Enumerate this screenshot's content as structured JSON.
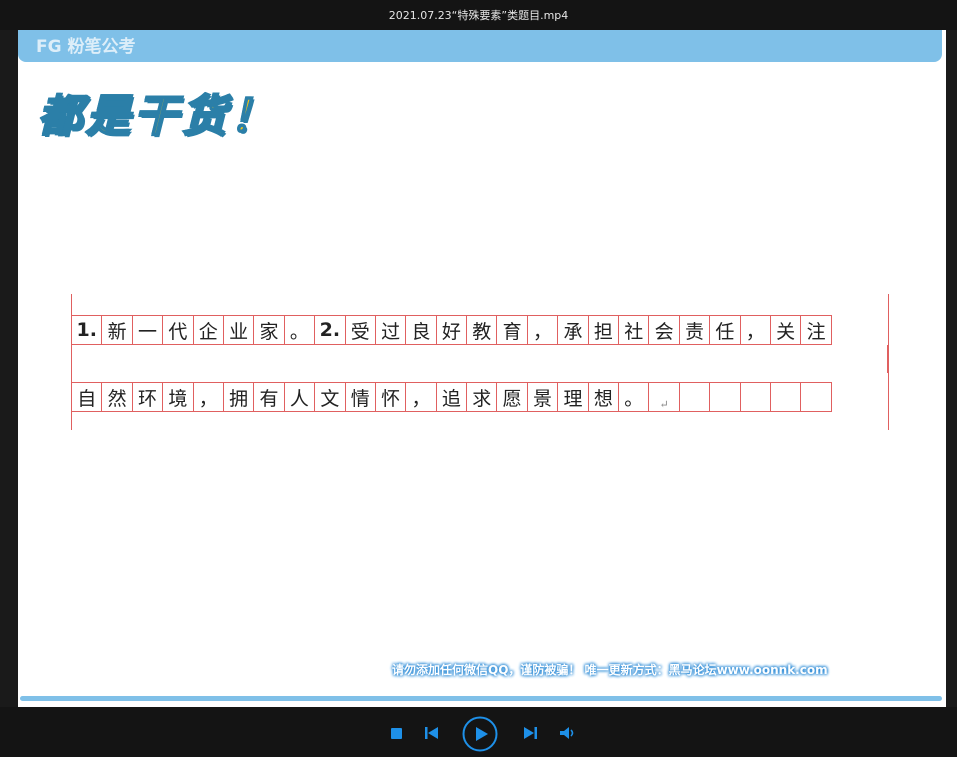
{
  "window": {
    "title": "2021.07.23“特殊要素”类题目.mp4"
  },
  "slide": {
    "brand": "FG 粉笔公考",
    "tagline": "都是干货！",
    "row1": [
      "1.",
      "新",
      "一",
      "代",
      "企",
      "业",
      "家",
      "。",
      "2.",
      "受",
      "过",
      "良",
      "好",
      "教",
      "育",
      "，",
      "承",
      "担",
      "社",
      "会",
      "责",
      "任",
      "，",
      "关",
      "注"
    ],
    "row2": [
      "自",
      "然",
      "环",
      "境",
      "，",
      "拥",
      "有",
      "人",
      "文",
      "情",
      "怀",
      "，",
      "追",
      "求",
      "愿",
      "景",
      "理",
      "想",
      "。",
      "↵",
      "",
      "",
      "",
      "",
      ""
    ],
    "watermark": "请勿添加任何微信QQ，谨防被骗！ 唯一更新方式：黑马论坛www.oonnk.com"
  },
  "controls": {
    "stop_icon": "stop-icon",
    "prev_icon": "skip-back-icon",
    "play_icon": "play-icon",
    "next_icon": "skip-forward-icon",
    "volume_icon": "volume-icon",
    "accent": "#1e90e8"
  }
}
